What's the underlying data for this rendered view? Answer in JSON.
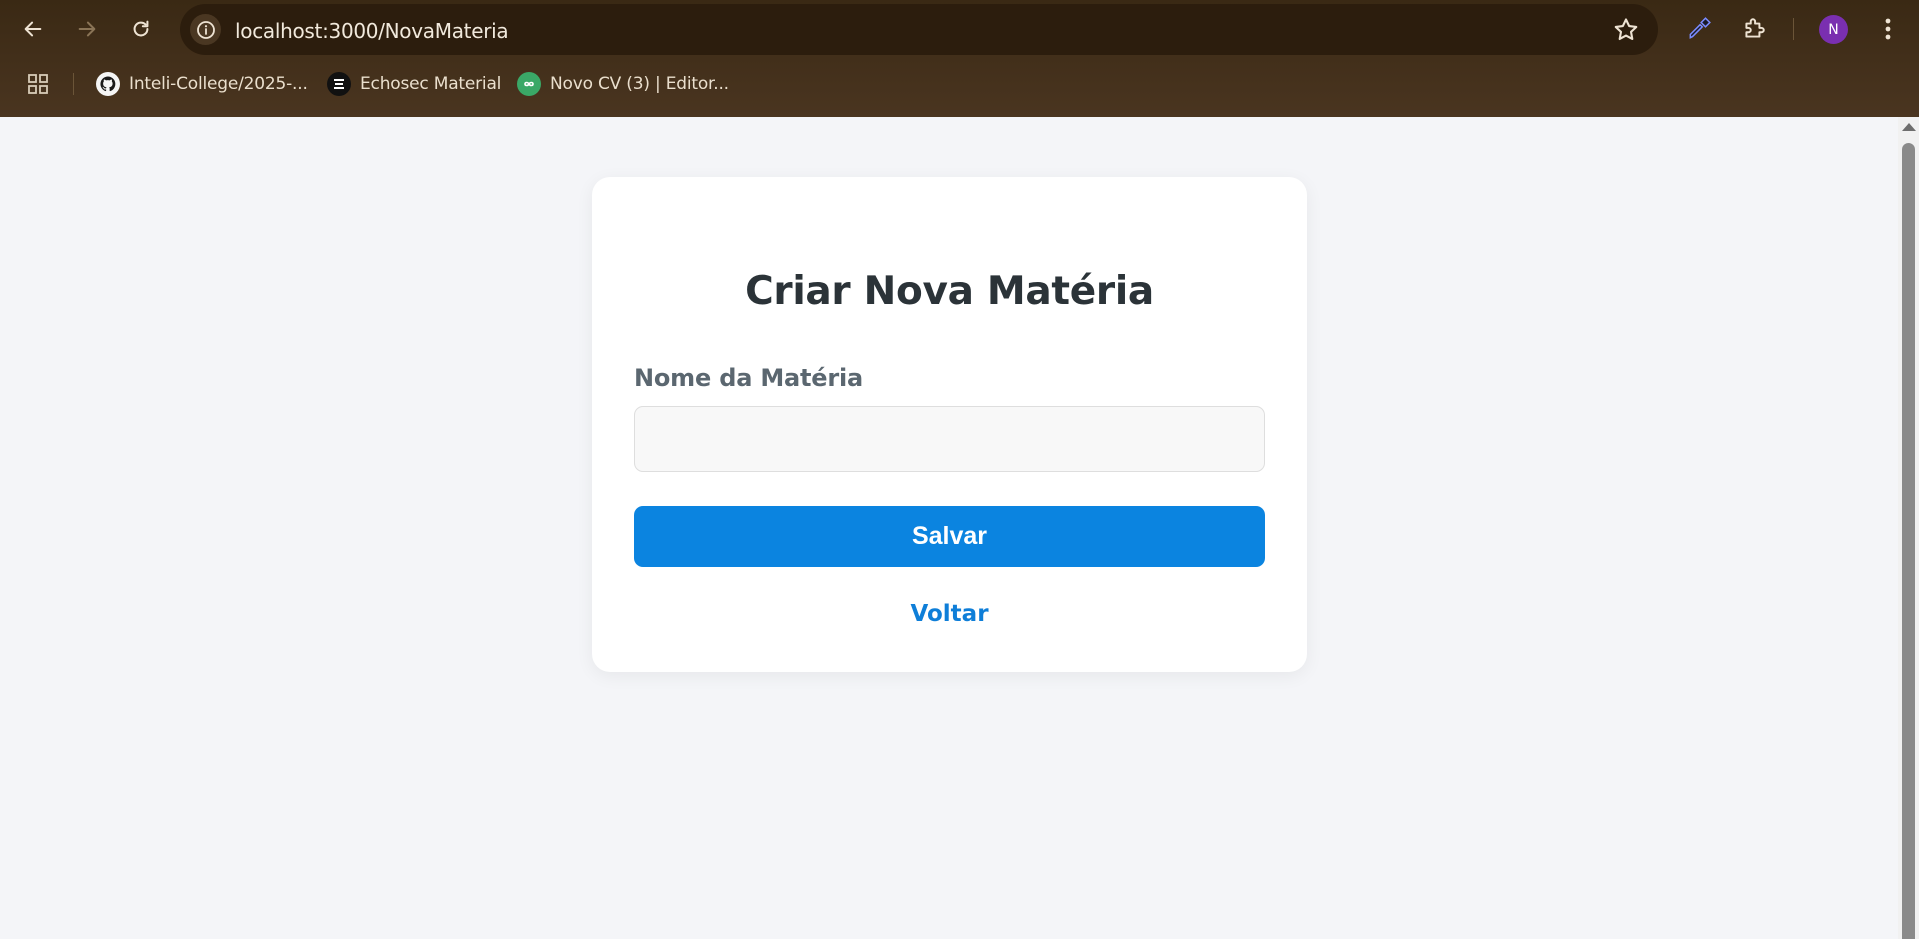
{
  "browser": {
    "url": "localhost:3000/NovaMateria",
    "avatar_initial": "N",
    "bookmarks": [
      {
        "label": "Inteli-College/2025-...",
        "icon": "github-icon"
      },
      {
        "label": "Echosec Material",
        "icon": "echosec-icon"
      },
      {
        "label": "Novo CV (3) | Editor...",
        "icon": "overleaf-icon"
      }
    ]
  },
  "form": {
    "title": "Criar Nova Matéria",
    "name_label": "Nome da Matéria",
    "name_value": "",
    "save_label": "Salvar",
    "back_label": "Voltar"
  },
  "colors": {
    "primary": "#0b84e0",
    "link": "#0e7ed8",
    "background": "#f4f5f8",
    "chrome": "#3a2914",
    "avatar": "#7a2fb0"
  }
}
